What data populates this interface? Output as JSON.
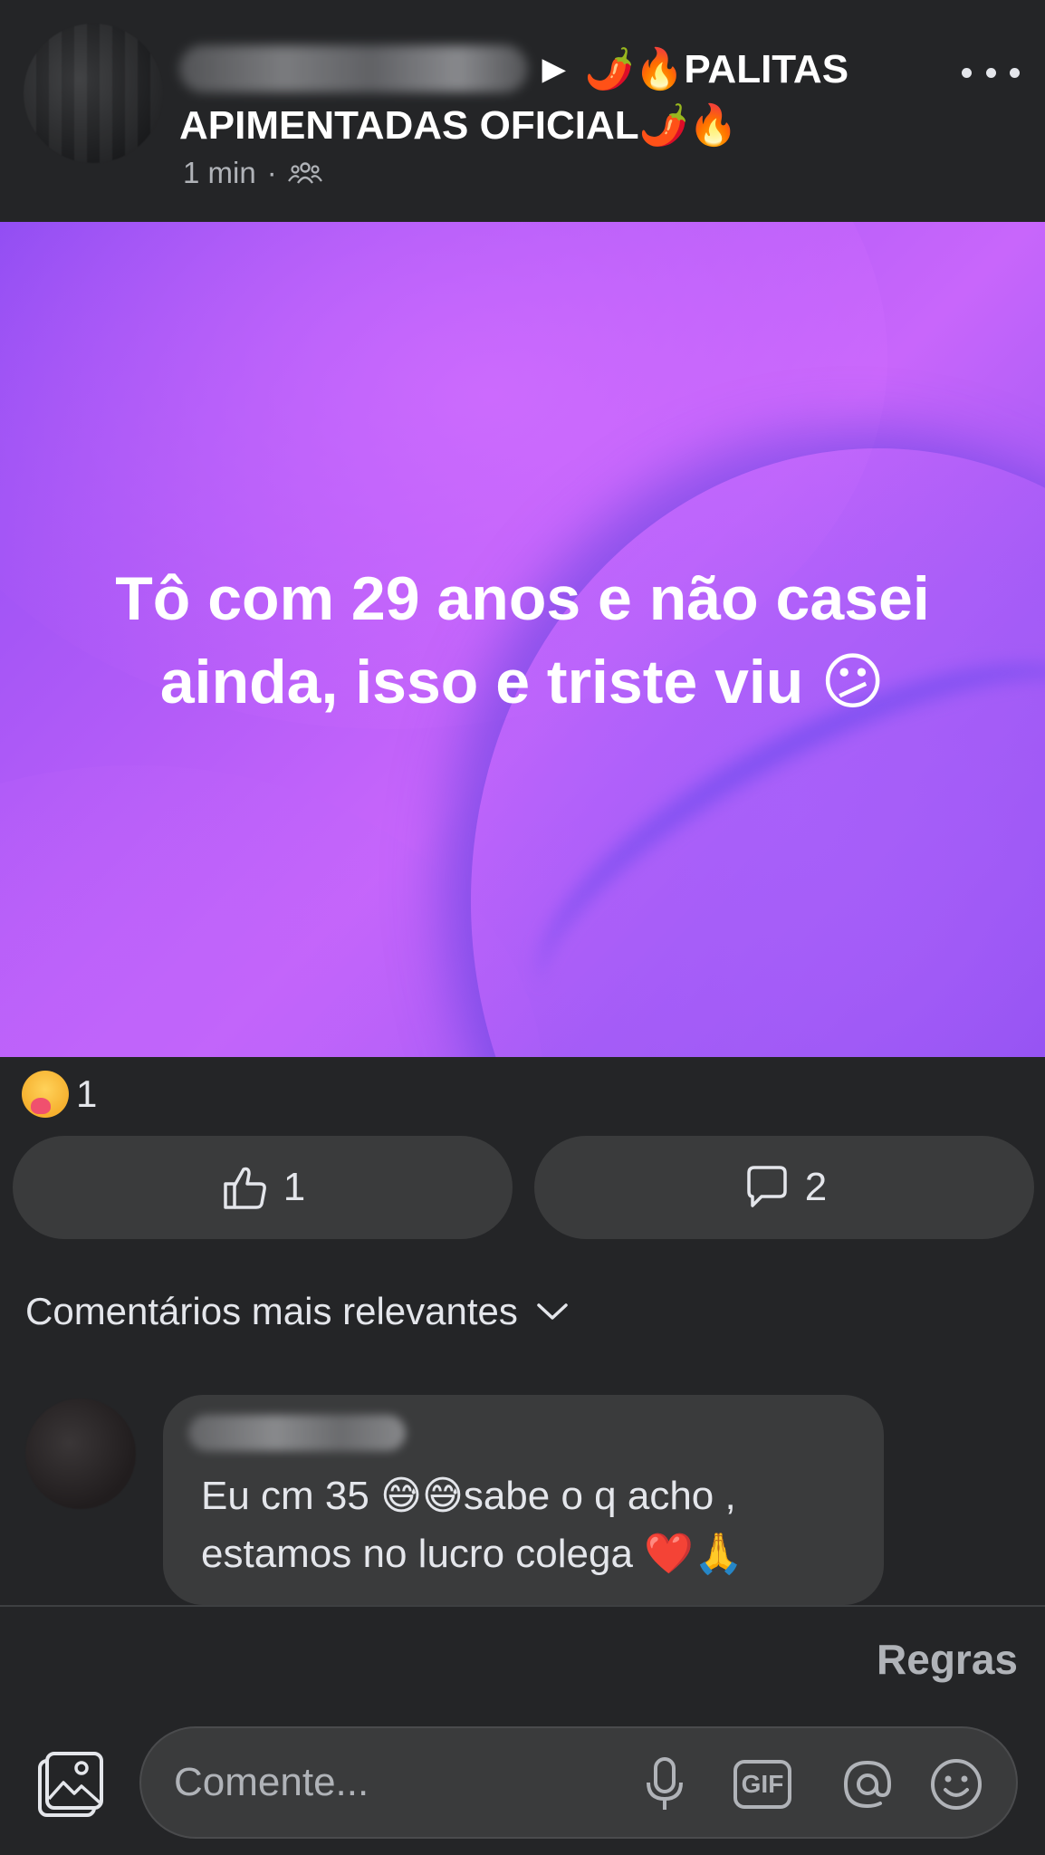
{
  "post": {
    "group_title": "► 🌶️🔥PALITAS APIMENTADAS  OFICIAL🌶️🔥",
    "time": "1 min",
    "separator": "·",
    "body_text": "Tô com 29 anos e não casei ainda, isso e triste viu 😕",
    "reaction_count": "1",
    "like_count": "1",
    "comment_count": "2"
  },
  "icons": {
    "more": "more-horizontal-icon",
    "audience": "group-icon",
    "reaction": "care-reaction-icon",
    "like": "thumbs-up-icon",
    "comment": "comment-bubble-icon",
    "sort": "chevron-down-icon",
    "photo": "photo-icon",
    "mic": "microphone-icon",
    "gif": "gif-icon",
    "mention": "at-icon",
    "emoji": "smiley-icon"
  },
  "comments": {
    "sort_label": "Comentários mais relevantes",
    "items": [
      {
        "text": "Eu cm 35  😅😅sabe o q acho , estamos no lucro colega ❤️🙏"
      }
    ]
  },
  "footer": {
    "rules_label": "Regras",
    "composer_placeholder": "Comente...",
    "gif_label": "GIF"
  },
  "colors": {
    "background": "#242527",
    "surface": "#3a3b3c",
    "text_primary": "#e4e6eb",
    "text_secondary": "#b0b3b8",
    "post_bg_start": "#8e4cf2",
    "post_bg_end": "#c866fb"
  }
}
